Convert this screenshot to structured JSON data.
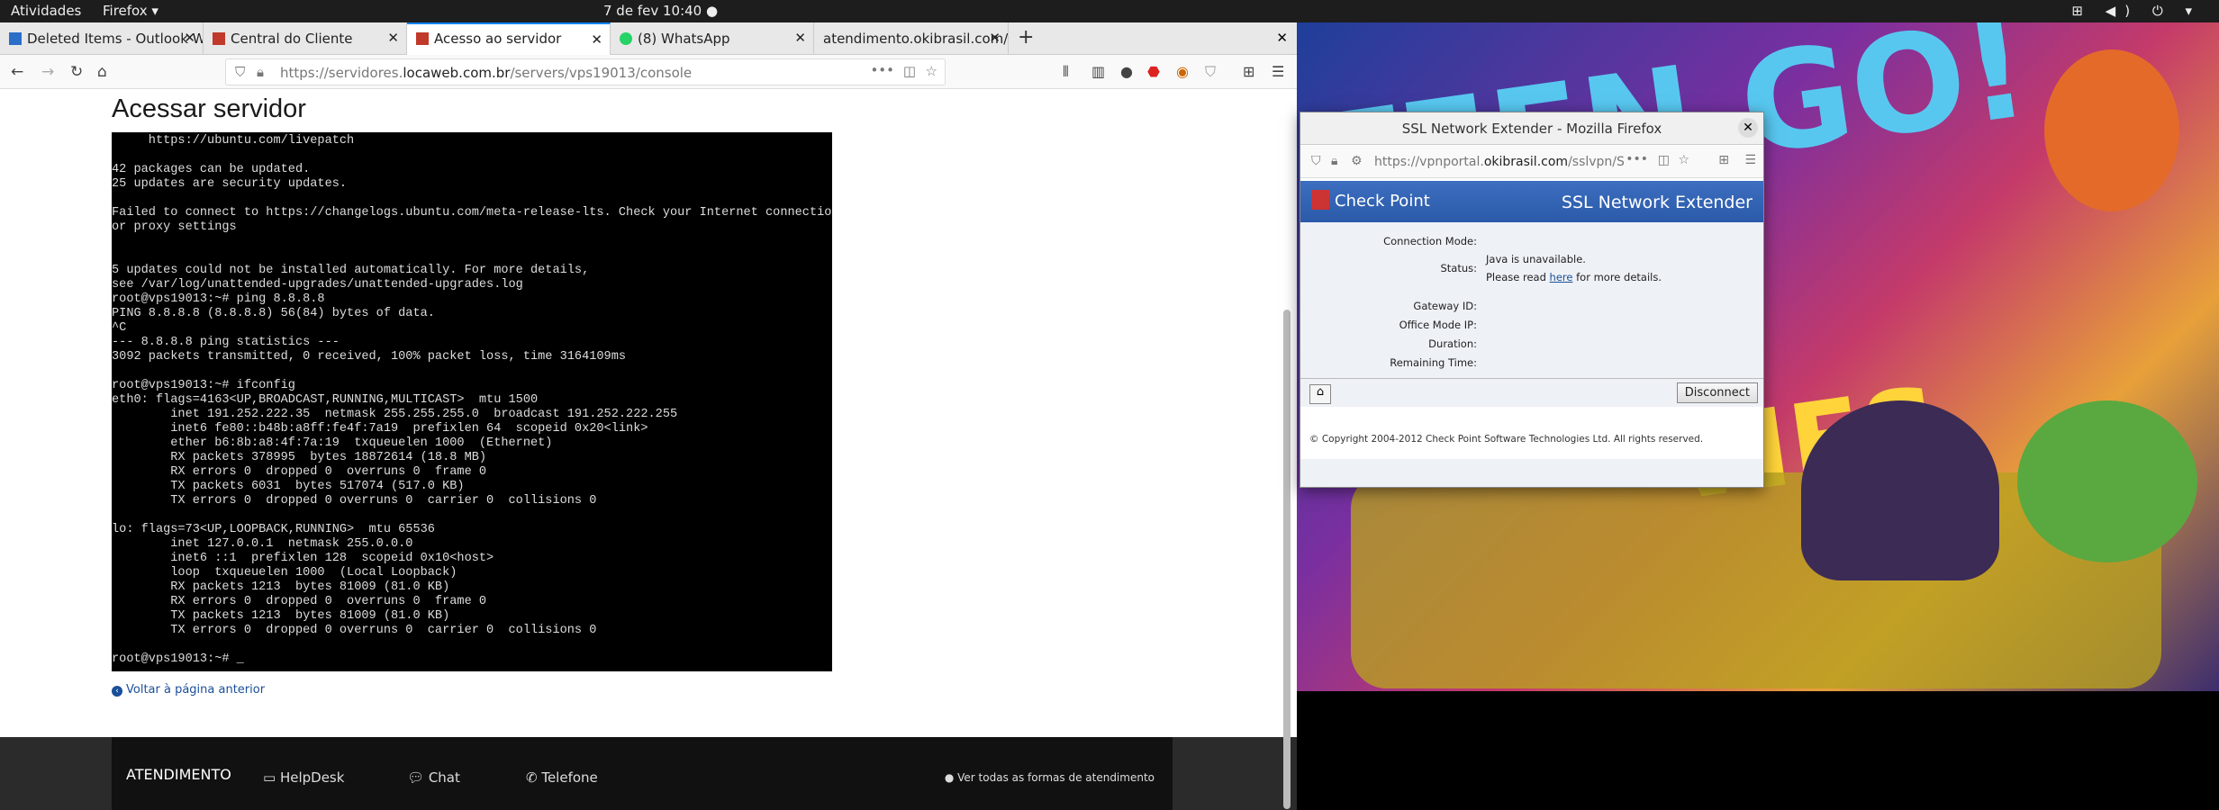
{
  "topbar": {
    "activities": "Atividades",
    "app": "Firefox ▾",
    "clock": "7 de fev  10:40 ●",
    "system": "⊞ ◀) ⏻ ▾"
  },
  "tabs": [
    {
      "label": "Deleted Items - Outlook We",
      "favcolor": "#2a6fc9"
    },
    {
      "label": "Central do Cliente",
      "favcolor": "#c0392b"
    },
    {
      "label": "Acesso ao servidor",
      "favcolor": "#c0392b"
    },
    {
      "label": "(8) WhatsApp",
      "favcolor": "#25d366"
    },
    {
      "label": "atendimento.okibrasil.com/c",
      "favcolor": ""
    }
  ],
  "nav": {
    "url_prefix": "https://servidores.",
    "url_domain": "locaweb.com.br",
    "url_path": "/servers/vps19013/console"
  },
  "page": {
    "title": "Acessar servidor",
    "terminal": "     https://ubuntu.com/livepatch\n\n42 packages can be updated.\n25 updates are security updates.\n\nFailed to connect to https://changelogs.ubuntu.com/meta-release-lts. Check your Internet connection\nor proxy settings\n\n\n5 updates could not be installed automatically. For more details,\nsee /var/log/unattended-upgrades/unattended-upgrades.log\nroot@vps19013:~# ping 8.8.8.8\nPING 8.8.8.8 (8.8.8.8) 56(84) bytes of data.\n^C\n--- 8.8.8.8 ping statistics ---\n3092 packets transmitted, 0 received, 100% packet loss, time 3164109ms\n\nroot@vps19013:~# ifconfig\neth0: flags=4163<UP,BROADCAST,RUNNING,MULTICAST>  mtu 1500\n        inet 191.252.222.35  netmask 255.255.255.0  broadcast 191.252.222.255\n        inet6 fe80::b48b:a8ff:fe4f:7a19  prefixlen 64  scopeid 0x20<link>\n        ether b6:8b:a8:4f:7a:19  txqueuelen 1000  (Ethernet)\n        RX packets 378995  bytes 18872614 (18.8 MB)\n        RX errors 0  dropped 0  overruns 0  frame 0\n        TX packets 6031  bytes 517074 (517.0 KB)\n        TX errors 0  dropped 0 overruns 0  carrier 0  collisions 0\n\nlo: flags=73<UP,LOOPBACK,RUNNING>  mtu 65536\n        inet 127.0.0.1  netmask 255.0.0.0\n        inet6 ::1  prefixlen 128  scopeid 0x10<host>\n        loop  txqueuelen 1000  (Local Loopback)\n        RX packets 1213  bytes 81009 (81.0 KB)\n        RX errors 0  dropped 0  overruns 0  frame 0\n        TX packets 1213  bytes 81009 (81.0 KB)\n        TX errors 0  dropped 0 overruns 0  carrier 0  collisions 0\n\nroot@vps19013:~# _",
    "back_link": "Voltar à página anterior"
  },
  "footer": {
    "atendimento": "ATENDIMENTO",
    "helpdesk": "HelpDesk",
    "chat": "Chat",
    "telefone": "Telefone",
    "all": "Ver todas as formas de atendimento"
  },
  "popup": {
    "title": "SSL Network Extender - Mozilla Firefox",
    "url_prefix": "https://vpnportal.",
    "url_domain": "okibrasil.com",
    "url_path": "/sslvpn/SN",
    "logo": "Check Point",
    "header": "SSL Network Extender",
    "labels": {
      "connection_mode": "Connection Mode:",
      "status": "Status:",
      "gateway_id": "Gateway ID:",
      "office_mode_ip": "Office Mode IP:",
      "duration": "Duration:",
      "remaining_time": "Remaining Time:"
    },
    "status_line1": "Java is unavailable.",
    "status_line2_pre": "Please read ",
    "status_link": "here",
    "status_line2_post": " for more details.",
    "disconnect": "Disconnect",
    "copyright": "© Copyright 2004-2012 Check Point Software Technologies Ltd. All rights reserved."
  },
  "wallpaper": {
    "text1": "TEEN GO!",
    "text2": "VIES"
  }
}
